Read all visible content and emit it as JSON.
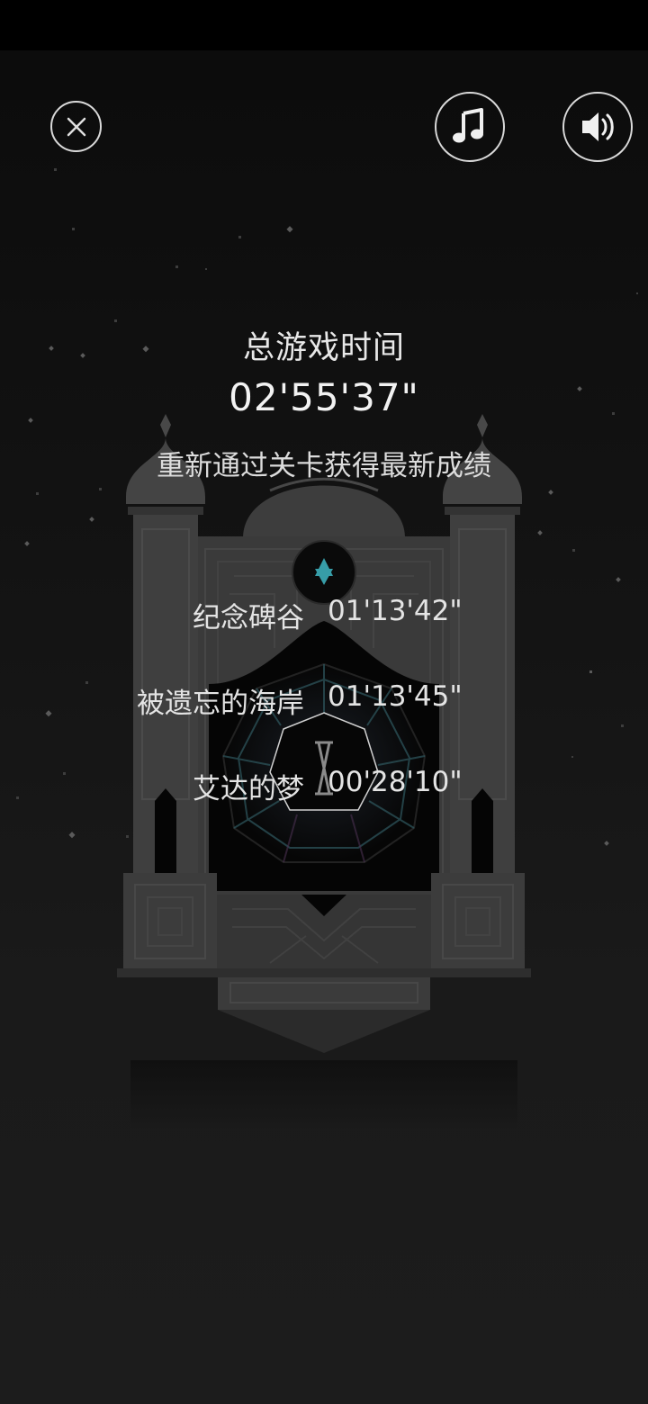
{
  "toolbar": {
    "close_icon": "close-circle-icon",
    "music_icon": "music-note-icon",
    "sound_icon": "speaker-volume-icon"
  },
  "summary": {
    "total_label": "总游戏时间",
    "total_time": "02'55'37\"",
    "replay_hint": "重新通过关卡获得最新成绩"
  },
  "levels": [
    {
      "name": "纪念碑谷",
      "time": "01'13'42\""
    },
    {
      "name": "被遗忘的海岸",
      "time": "01'13'45\""
    },
    {
      "name": "艾达的梦",
      "time": "00'28'10\""
    }
  ],
  "colors": {
    "background": "#121212",
    "text": "#e6e6e6",
    "monument": "#3a3a3a",
    "accent_gem": "#3fb7c4"
  }
}
